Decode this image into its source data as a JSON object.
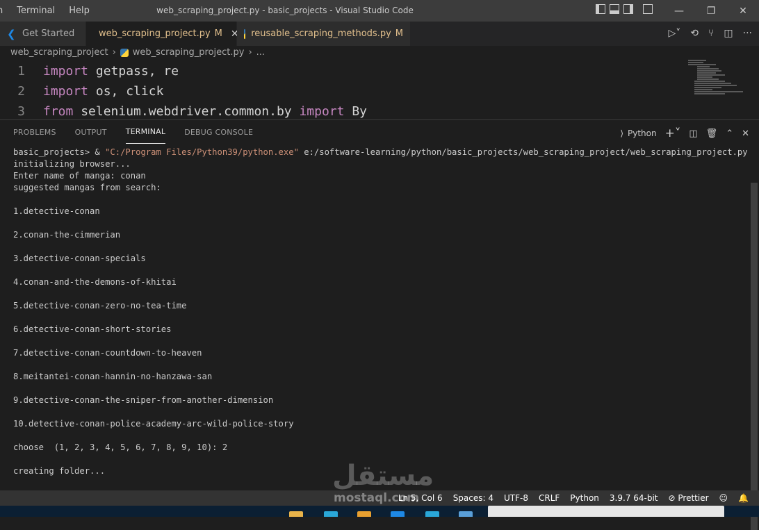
{
  "menu": {
    "items": [
      "n",
      "Terminal",
      "Help"
    ]
  },
  "window": {
    "title": "web_scraping_project.py - basic_projects - Visual Studio Code"
  },
  "tabs": [
    {
      "label": "Get Started",
      "modified": ""
    },
    {
      "label": "web_scraping_project.py",
      "modified": "M",
      "close": "✕"
    },
    {
      "label": "reusable_scraping_methods.py",
      "modified": "M"
    }
  ],
  "breadcrumb": {
    "folder": "web_scraping_project",
    "file": "web_scraping_project.py",
    "more": "..."
  },
  "editor": {
    "lines": [
      {
        "num": "1",
        "kw": "import",
        "rest": " getpass, re",
        "kw2": "",
        "rest2": ""
      },
      {
        "num": "2",
        "kw": "import",
        "rest": " os, click",
        "kw2": "",
        "rest2": ""
      },
      {
        "num": "3",
        "kw": "from",
        "rest": " selenium.webdriver.common.by ",
        "kw2": "import",
        "rest2": " By"
      }
    ]
  },
  "panel": {
    "tabs": [
      "PROBLEMS",
      "OUTPUT",
      "TERMINAL",
      "DEBUG CONSOLE"
    ],
    "shell": "Python"
  },
  "terminal": {
    "prompt": "basic_projects> & ",
    "exe": "\"C:/Program Files/Python39/python.exe\"",
    "script": " e:/software-learning/python/basic_projects/web_scraping_project/web_scraping_project.py",
    "lines": [
      "initializing browser...",
      "Enter name of manga: conan",
      "suggested mangas from search:",
      "",
      "1.detective-conan",
      "",
      "2.conan-the-cimmerian",
      "",
      "3.detective-conan-specials",
      "",
      "4.conan-and-the-demons-of-khitai",
      "",
      "5.detective-conan-zero-no-tea-time",
      "",
      "6.detective-conan-short-stories",
      "",
      "7.detective-conan-countdown-to-heaven",
      "",
      "8.meitantei-conan-hannin-no-hanzawa-san",
      "",
      "9.detective-conan-the-sniper-from-another-dimension",
      "",
      "10.detective-conan-police-academy-arc-wild-police-story",
      "",
      "choose  (1, 2, 3, 4, 5, 6, 7, 8, 9, 10): 2",
      "",
      "creating folder..."
    ]
  },
  "status": {
    "position": "Ln 5, Col 6",
    "spaces": "Spaces: 4",
    "encoding": "UTF-8",
    "eol": "CRLF",
    "language": "Python",
    "interpreter": "3.9.7 64-bit",
    "formatter": "⊘ Prettier"
  },
  "watermark": {
    "ar": "مستقل",
    "en": "mostaql.com"
  }
}
